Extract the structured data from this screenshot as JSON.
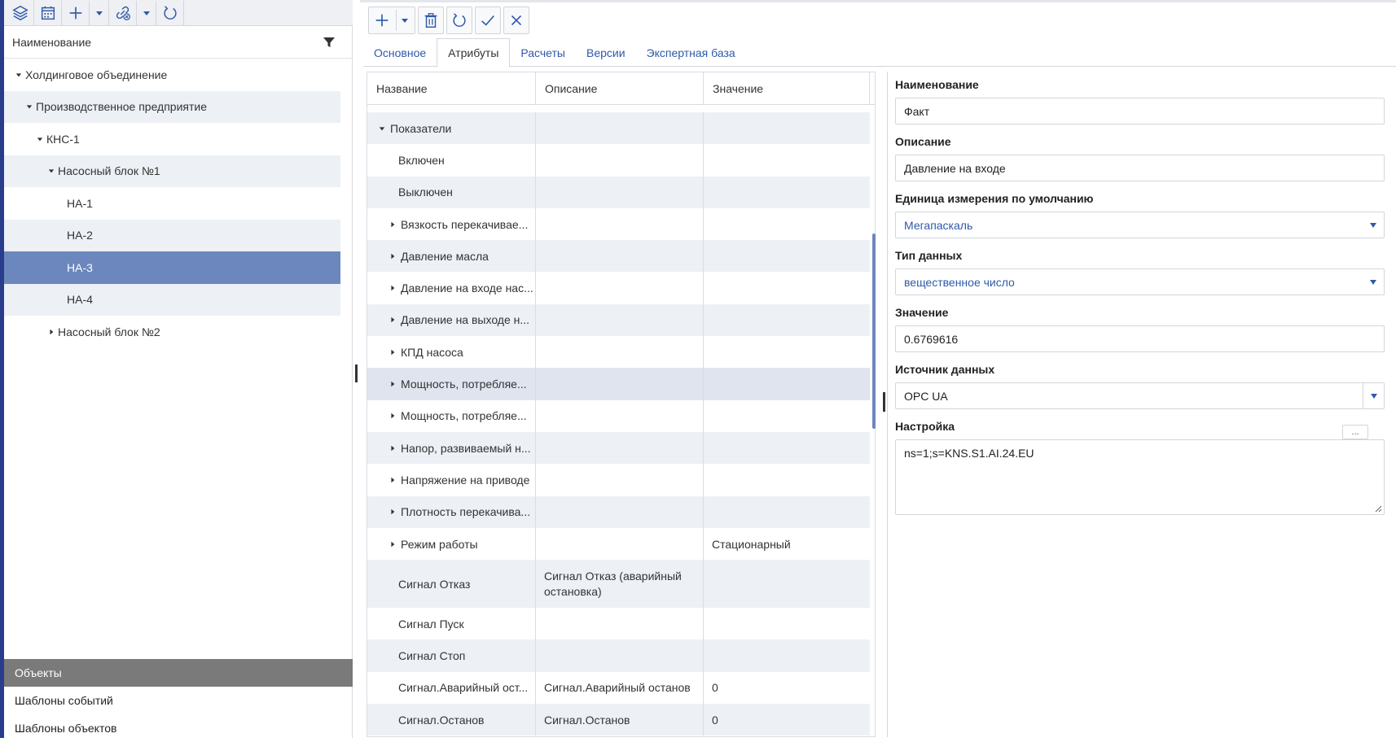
{
  "left_panel": {
    "toolbar": {
      "layers": "layers-icon",
      "calendar": "calendar-icon",
      "add": "plus-icon",
      "link": "link-remove-icon",
      "refresh": "refresh-icon"
    },
    "tree_header": {
      "label": "Наименование",
      "filter": "filter-icon"
    },
    "tree": [
      {
        "label": "Холдинговое объединение",
        "level": 0,
        "state": "expanded"
      },
      {
        "label": "Производственное предприятие",
        "level": 1,
        "state": "expanded"
      },
      {
        "label": "КНС-1",
        "level": 2,
        "state": "expanded"
      },
      {
        "label": "Насосный блок №1",
        "level": 3,
        "state": "expanded"
      },
      {
        "label": "НА-1",
        "level": 4,
        "state": "leaf"
      },
      {
        "label": "НА-2",
        "level": 4,
        "state": "leaf"
      },
      {
        "label": "НА-3",
        "level": 4,
        "state": "leaf",
        "selected": true
      },
      {
        "label": "НА-4",
        "level": 4,
        "state": "leaf"
      },
      {
        "label": "Насосный блок №2",
        "level": 3,
        "state": "collapsed"
      }
    ],
    "footer": [
      {
        "label": "Объекты",
        "active": true
      },
      {
        "label": "Шаблоны событий"
      },
      {
        "label": "Шаблоны объектов"
      }
    ]
  },
  "main_toolbar": {
    "add": "plus-icon",
    "delete": "trash-icon",
    "refresh": "refresh-icon",
    "apply": "check-icon",
    "cancel": "close-icon"
  },
  "tabs": [
    {
      "label": "Основное"
    },
    {
      "label": "Атрибуты",
      "active": true
    },
    {
      "label": "Расчеты"
    },
    {
      "label": "Версии"
    },
    {
      "label": "Экспертная база"
    }
  ],
  "grid": {
    "columns": [
      "Название",
      "Описание",
      "Значение"
    ],
    "rows": [
      {
        "name": "Показатели",
        "desc": "",
        "value": "",
        "level": 0,
        "state": "expanded"
      },
      {
        "name": "Включен",
        "desc": "",
        "value": "",
        "level": 1,
        "state": "leaf"
      },
      {
        "name": "Выключен",
        "desc": "",
        "value": "",
        "level": 1,
        "state": "leaf"
      },
      {
        "name": "Вязкость перекачивае...",
        "desc": "",
        "value": "",
        "level": 1,
        "state": "collapsed"
      },
      {
        "name": "Давление масла",
        "desc": "",
        "value": "",
        "level": 1,
        "state": "collapsed"
      },
      {
        "name": "Давление на входе нас...",
        "desc": "",
        "value": "",
        "level": 1,
        "state": "collapsed"
      },
      {
        "name": "Давление на выходе н...",
        "desc": "",
        "value": "",
        "level": 1,
        "state": "collapsed"
      },
      {
        "name": "КПД насоса",
        "desc": "",
        "value": "",
        "level": 1,
        "state": "collapsed"
      },
      {
        "name": "Мощность, потребляе...",
        "desc": "",
        "value": "",
        "level": 1,
        "state": "collapsed",
        "highlight": true
      },
      {
        "name": "Мощность, потребляе...",
        "desc": "",
        "value": "",
        "level": 1,
        "state": "collapsed"
      },
      {
        "name": "Напор, развиваемый н...",
        "desc": "",
        "value": "",
        "level": 1,
        "state": "collapsed"
      },
      {
        "name": "Напряжение на приводе",
        "desc": "",
        "value": "",
        "level": 1,
        "state": "collapsed"
      },
      {
        "name": "Плотность перекачива...",
        "desc": "",
        "value": "",
        "level": 1,
        "state": "collapsed"
      },
      {
        "name": "Режим работы",
        "desc": "",
        "value": "Стационарный",
        "level": 1,
        "state": "collapsed"
      },
      {
        "name": "Сигнал Отказ",
        "desc": "Сигнал Отказ (аварийный остановка)",
        "value": "",
        "level": 1,
        "state": "leaf",
        "tall": true
      },
      {
        "name": "Сигнал Пуск",
        "desc": "",
        "value": "",
        "level": 1,
        "state": "leaf"
      },
      {
        "name": "Сигнал Стоп",
        "desc": "",
        "value": "",
        "level": 1,
        "state": "leaf"
      },
      {
        "name": "Сигнал.Аварийный ост...",
        "desc": "Сигнал.Аварийный останов",
        "value": "0",
        "level": 1,
        "state": "leaf"
      },
      {
        "name": "Сигнал.Останов",
        "desc": "Сигнал.Останов",
        "value": "0",
        "level": 1,
        "state": "leaf"
      }
    ]
  },
  "form": {
    "name": {
      "label": "Наименование",
      "value": "Факт"
    },
    "description": {
      "label": "Описание",
      "value": "Давление на входе"
    },
    "unit": {
      "label": "Единица измерения по умолчанию",
      "value": "Мегапаскаль"
    },
    "datatype": {
      "label": "Тип данных",
      "value": "вещественное число"
    },
    "value": {
      "label": "Значение",
      "value": "0.6769616"
    },
    "source": {
      "label": "Источник данных",
      "value": "OPC UA"
    },
    "config": {
      "label": "Настройка",
      "button": "...",
      "value": "ns=1;s=KNS.S1.AI.24.EU"
    }
  },
  "colors": {
    "accent": "#2a3c8c",
    "selected_row": "#6c87bd",
    "alt_row": "#edf0f5",
    "link": "#2f5aa8",
    "footer_active": "#7a7a7a"
  }
}
